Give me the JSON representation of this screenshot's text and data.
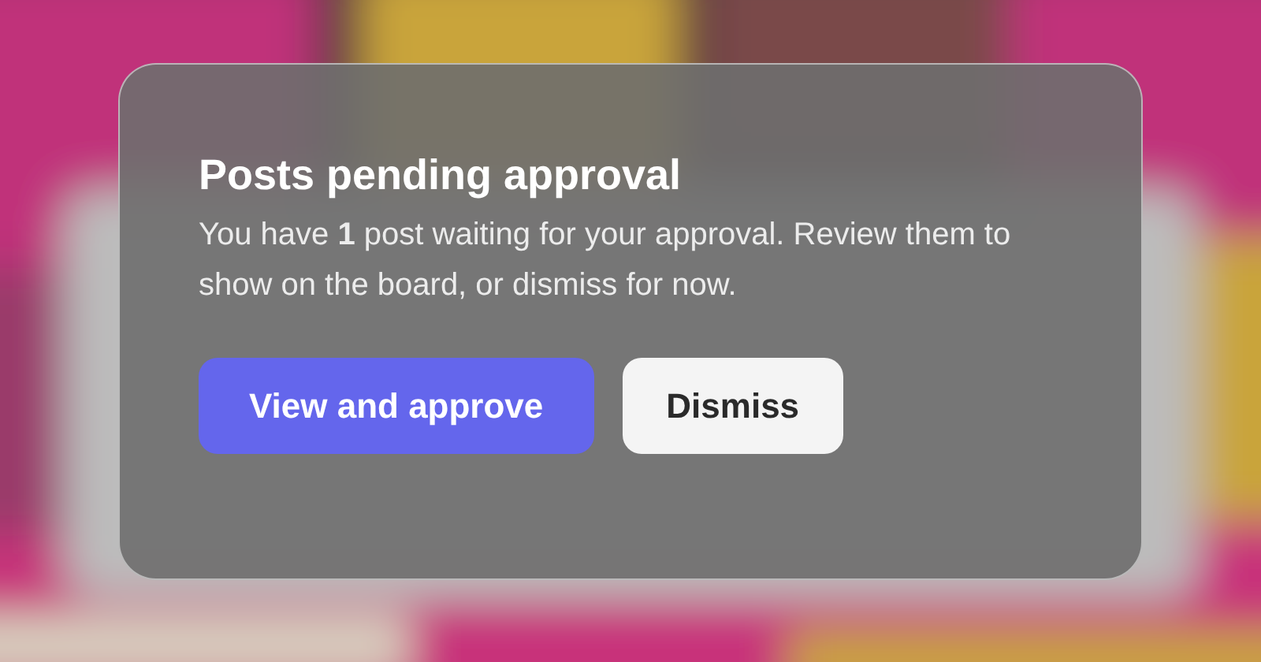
{
  "dialog": {
    "title": "Posts pending approval",
    "message": "You have **1** post waiting for your approval. Review them to show on the board, or dismiss for now.",
    "buttons": [
      {
        "label": "View and approve",
        "kind": "primary"
      },
      {
        "label": "Dismiss",
        "kind": "secondary"
      }
    ]
  }
}
